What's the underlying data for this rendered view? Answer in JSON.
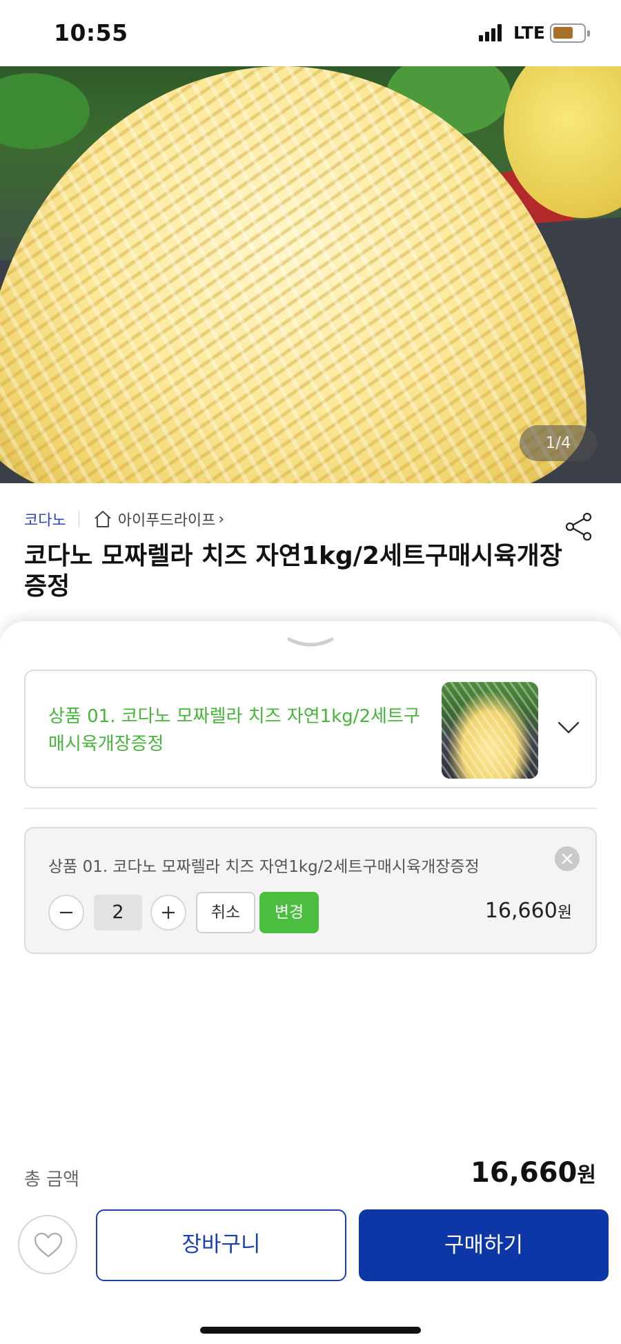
{
  "status_bar": {
    "time": "10:55",
    "network": "LTE",
    "battery_level": 0.55,
    "battery_color": "#a8702a"
  },
  "hero": {
    "image_counter": "1/4",
    "image_desc_icon": "product-photo-icon"
  },
  "product": {
    "brand": "코다노",
    "shop_name": "아이푸드라이프",
    "shop_chevron": "›",
    "title": "코다노 모짜렐라 치즈 자연1kg/2세트구매시육개장증정",
    "share_icon": "share-icon"
  },
  "option_select": {
    "label": "상품 01. 코다노 모짜렐라 치즈 자연1kg/2세트구매시육개장증정",
    "label_color": "#46b53a"
  },
  "selected_item": {
    "name": "상품 01. 코다노 모짜렐라 치즈 자연1kg/2세트구매시육개장증정",
    "quantity": "2",
    "cancel_label": "취소",
    "change_label": "변경",
    "price": "16,660",
    "price_unit": "원"
  },
  "total": {
    "label": "총 금액",
    "value": "16,660",
    "unit": "원"
  },
  "actions": {
    "cart_label": "장바구니",
    "buy_label": "구매하기",
    "primary_color": "#0d37a6"
  }
}
